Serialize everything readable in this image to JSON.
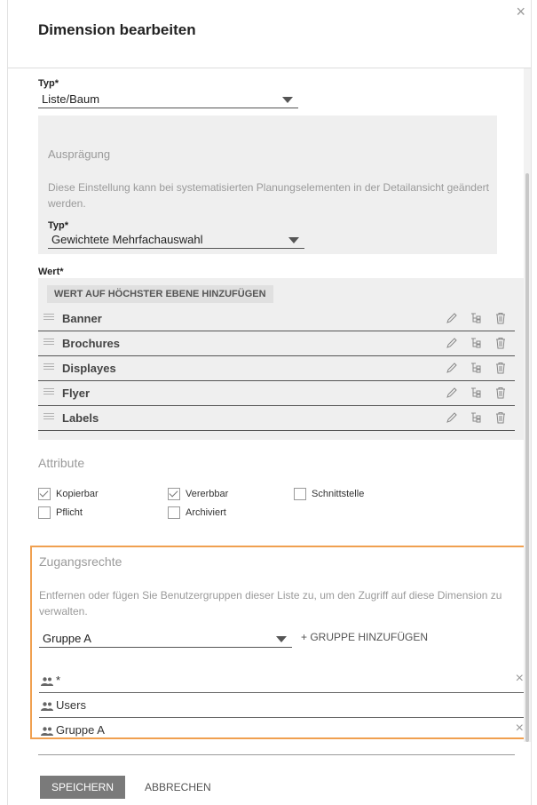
{
  "dialog": {
    "title": "Dimension bearbeiten",
    "close": "×"
  },
  "typ": {
    "label": "Typ*",
    "value": "Liste/Baum"
  },
  "auspraegung": {
    "title": "Ausprägung",
    "description": "Diese Einstellung kann bei systematisierten Planungselementen in der Detailansicht geändert werden.",
    "typ_label": "Typ*",
    "typ_value": "Gewichtete Mehrfachauswahl"
  },
  "wert": {
    "label": "Wert*",
    "add_top_label": "WERT AUF HÖCHSTER EBENE HINZUFÜGEN",
    "items": [
      {
        "name": "Banner"
      },
      {
        "name": "Brochures"
      },
      {
        "name": "Displayes"
      },
      {
        "name": "Flyer"
      },
      {
        "name": "Labels"
      }
    ]
  },
  "attribute": {
    "title": "Attribute",
    "items": [
      {
        "label": "Kopierbar",
        "checked": true
      },
      {
        "label": "Vererbbar",
        "checked": true
      },
      {
        "label": "Schnittstelle",
        "checked": false
      },
      {
        "label": "Pflicht",
        "checked": false
      },
      {
        "label": "Archiviert",
        "checked": false
      }
    ]
  },
  "zugangsrechte": {
    "title": "Zugangsrechte",
    "description": "Entfernen oder fügen Sie Benutzergruppen dieser Liste zu, um den Zugriff auf diese Dimension zu verwalten.",
    "select_value": "Gruppe A",
    "add_group_label": "+ GRUPPE HINZUFÜGEN",
    "groups": [
      {
        "name": "*",
        "removable": true
      },
      {
        "name": "Users",
        "removable": false
      },
      {
        "name": "Gruppe A",
        "removable": true
      }
    ]
  },
  "footer": {
    "save_label": "SPEICHERN",
    "cancel_label": "ABBRECHEN"
  },
  "colors": {
    "accent_border": "#f0a050",
    "primary_button": "#7a7a7a",
    "panel_bg": "#efefef"
  }
}
